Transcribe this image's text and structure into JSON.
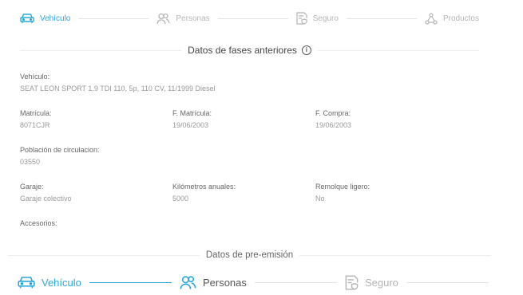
{
  "stepper_top": [
    {
      "label": "Vehículo",
      "state": "active"
    },
    {
      "label": "Personas",
      "state": "inactive"
    },
    {
      "label": "Seguro",
      "state": "inactive"
    },
    {
      "label": "Productos",
      "state": "inactive"
    }
  ],
  "section_fases": {
    "title": "Datos de fases anteriores",
    "info_glyph": "i"
  },
  "fields": {
    "vehiculo": {
      "label": "Vehículo:",
      "value": "SEAT LEON SPORT 1.9 TDI 110, 5p, 110 CV, 11/1999 Diesel"
    },
    "matricula": {
      "label": "Matrícula:",
      "value": "8071CJR"
    },
    "f_matricula": {
      "label": "F. Matrícula:",
      "value": "19/06/2003"
    },
    "f_compra": {
      "label": "F. Compra:",
      "value": "19/06/2003"
    },
    "poblacion": {
      "label": "Población de circulacion:",
      "value": "03550"
    },
    "garaje": {
      "label": "Garaje:",
      "value": "Garaje colectivo"
    },
    "km_anuales": {
      "label": "Kilómetros anuales:",
      "value": "5000"
    },
    "remolque": {
      "label": "Remolque ligero:",
      "value": "No"
    },
    "accesorios": {
      "label": "Accesorios:",
      "value": ""
    }
  },
  "section_pre": {
    "title": "Datos de pre-emisión"
  },
  "stepper_bottom": [
    {
      "label": "Vehículo",
      "state": "active"
    },
    {
      "label": "Personas",
      "state": "current"
    },
    {
      "label": "Seguro",
      "state": "inactive"
    }
  ],
  "colors": {
    "accent": "#2aa8dc",
    "inactive": "#b5b5b5",
    "rule": "#e3e3e3"
  },
  "icons": {
    "vehiculo": "car-icon",
    "personas": "people-icon",
    "seguro": "shield-document-icon",
    "productos": "nodes-icon"
  }
}
